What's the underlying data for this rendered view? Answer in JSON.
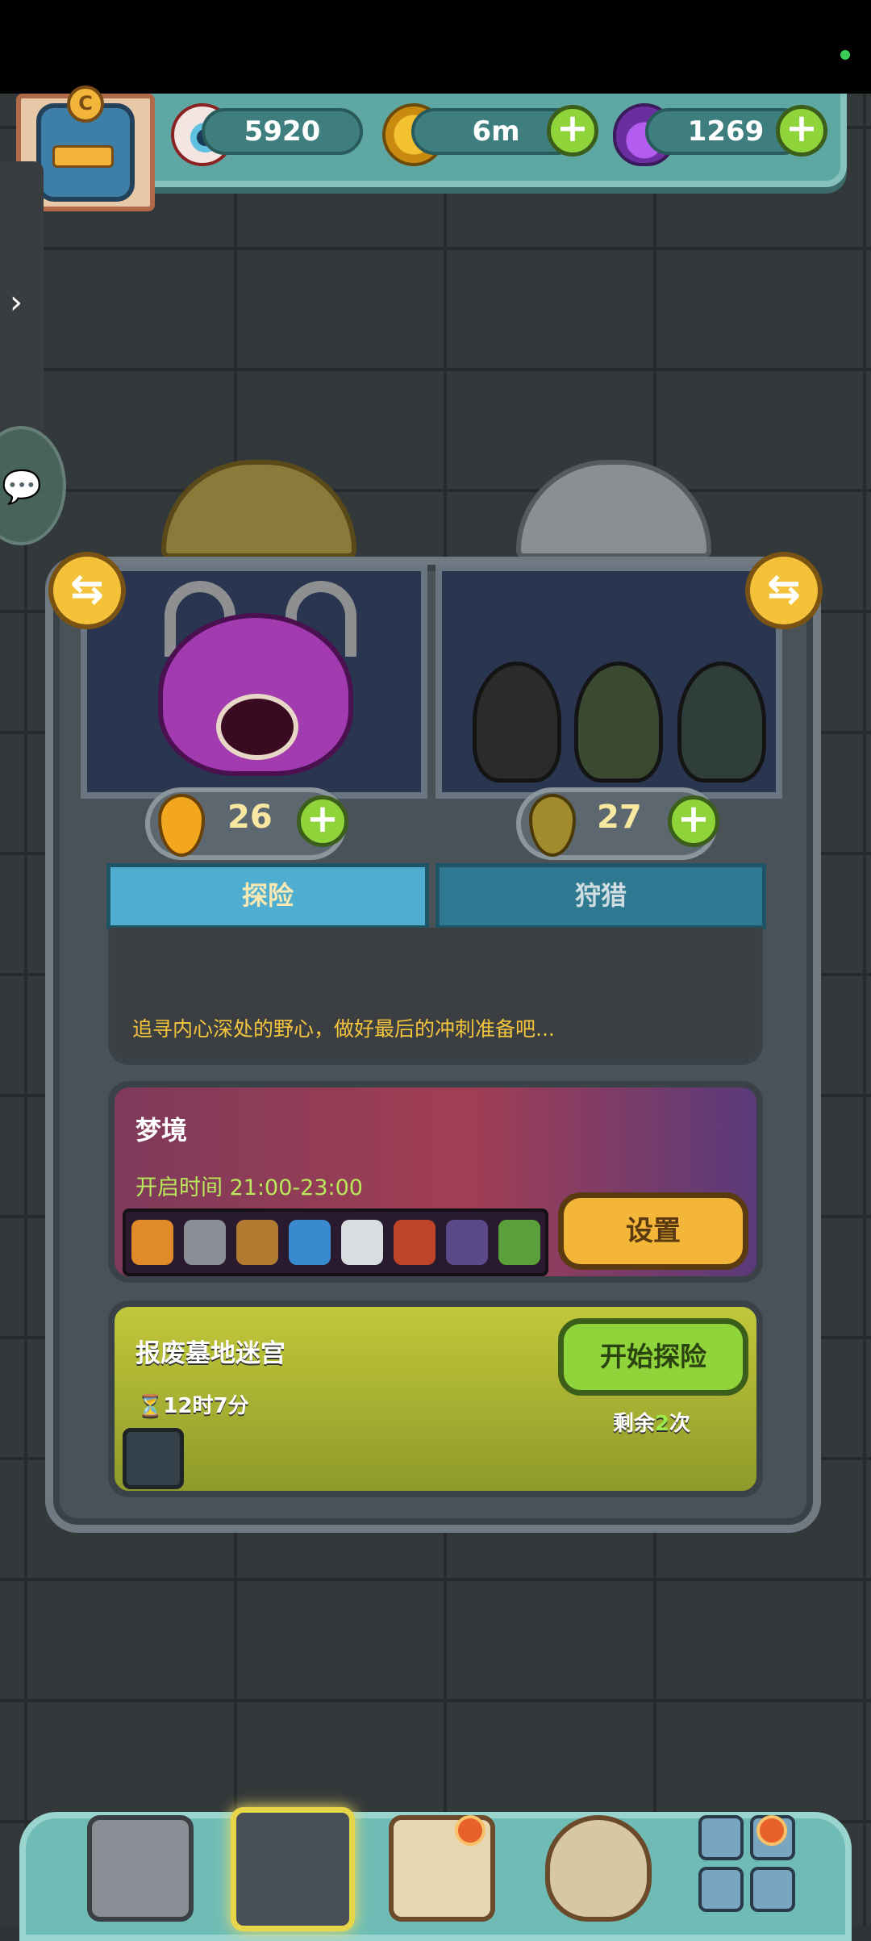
{
  "resources": {
    "eyes": "5920",
    "coins": "6m",
    "potions": "1269"
  },
  "energy": {
    "left": "26",
    "right": "27"
  },
  "tabs": [
    "探险",
    "狩猎"
  ],
  "adventure_desc": "追寻内心深处的野心，做好最后的冲刺准备吧...",
  "dream": {
    "title": "梦境",
    "open_time": "开启时间 21:00-23:00",
    "settings_label": "设置"
  },
  "maze": {
    "title": "报废墓地迷宫",
    "timer": "12时7分",
    "start_label": "开始探险",
    "remaining_prefix": "剩余",
    "remaining_count": "2",
    "remaining_suffix": "次"
  },
  "colors": {
    "accent_green": "#8fd43b",
    "accent_gold": "#f3b639",
    "tab_blue": "#4faed0"
  }
}
